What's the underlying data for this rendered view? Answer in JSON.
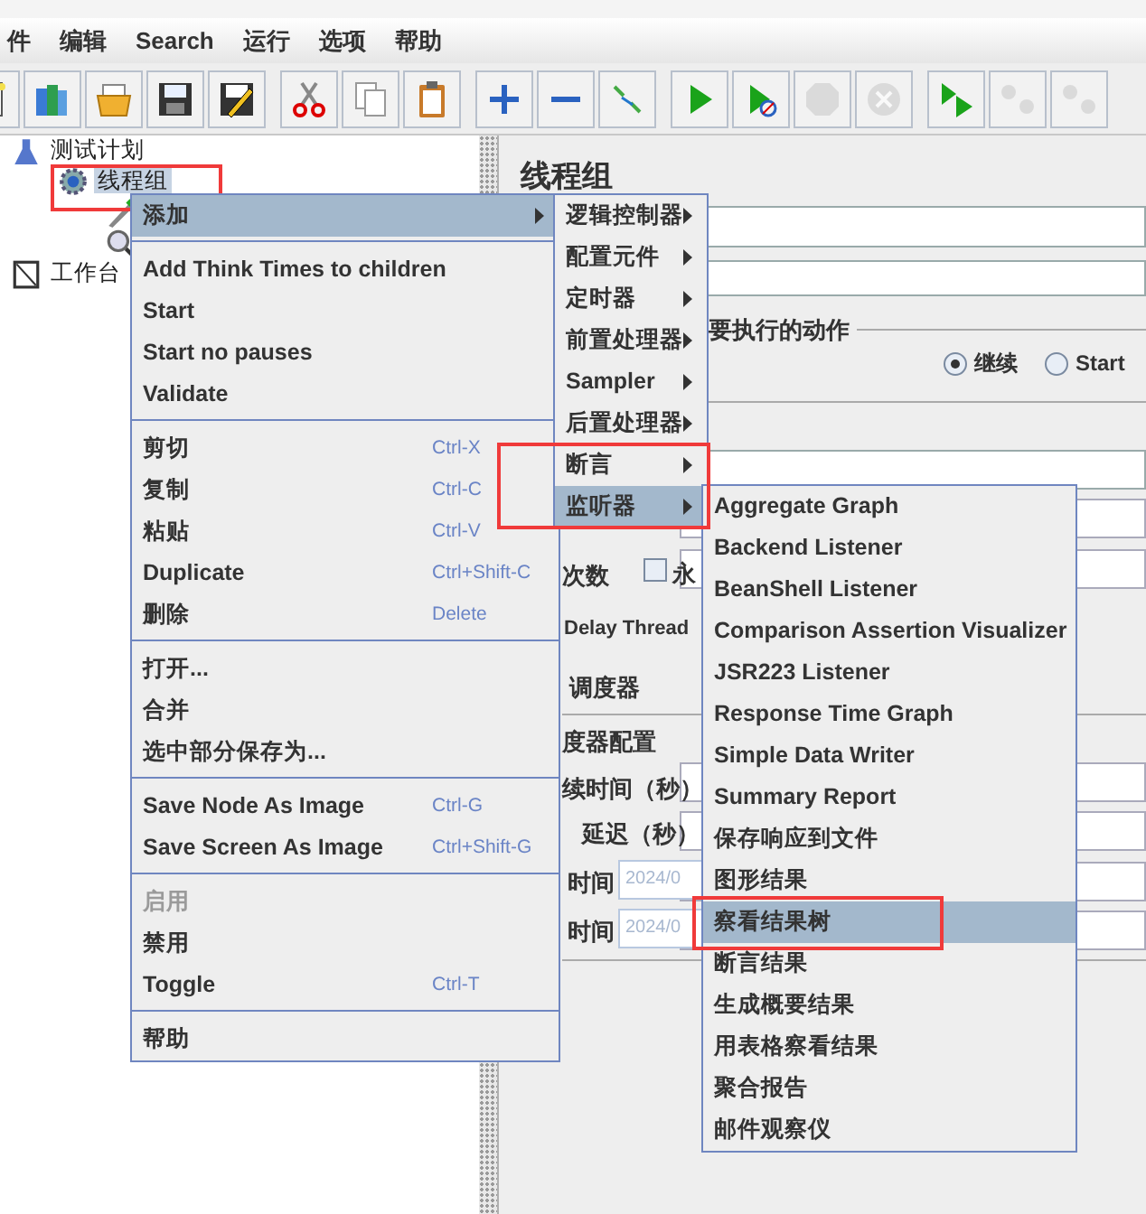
{
  "menu_bar": [
    "件",
    "编辑",
    "Search",
    "运行",
    "选项",
    "帮助"
  ],
  "toolbar": [
    [
      {
        "kind": "new",
        "disabled": false
      },
      {
        "kind": "templates",
        "disabled": false
      },
      {
        "kind": "open",
        "disabled": false
      },
      {
        "kind": "save",
        "disabled": false
      },
      {
        "kind": "save_as",
        "disabled": false
      }
    ],
    [
      {
        "kind": "cut",
        "disabled": false
      },
      {
        "kind": "copy",
        "disabled": false
      },
      {
        "kind": "paste",
        "disabled": false
      }
    ],
    [
      {
        "kind": "expand",
        "disabled": false
      },
      {
        "kind": "collapse",
        "disabled": false
      },
      {
        "kind": "toggle",
        "disabled": false
      }
    ],
    [
      {
        "kind": "start",
        "disabled": false
      },
      {
        "kind": "start_no_pauses",
        "disabled": false
      },
      {
        "kind": "stop",
        "disabled": true
      },
      {
        "kind": "shutdown",
        "disabled": true
      }
    ],
    [
      {
        "kind": "remote_start",
        "disabled": false
      },
      {
        "kind": "remote_stop",
        "disabled": true
      },
      {
        "kind": "remote_exit",
        "disabled": true
      }
    ]
  ],
  "tree": [
    {
      "kind": "test_plan",
      "label": "测试计划",
      "selected": false,
      "children": [
        {
          "kind": "thread_group",
          "label": "线程组",
          "selected": true,
          "children": [
            {
              "kind": "pencil"
            },
            {
              "kind": "magnifier"
            }
          ]
        }
      ]
    },
    {
      "kind": "workbench",
      "label": "工作台",
      "selected": false
    }
  ],
  "panel": {
    "title": "线程组",
    "action_group": "要执行的动作",
    "radios": [
      {
        "label": "继续",
        "selected": true
      },
      {
        "label": "Start",
        "selected": false
      }
    ],
    "loop_forever": {
      "checked": false
    },
    "labels": [
      "次数",
      "永",
      "Delay Thread",
      "调度器",
      "度器配置",
      "续时间（秒）",
      "延迟（秒）"
    ],
    "start_time": {
      "label": "时间",
      "value": "2024/0"
    },
    "end_time": {
      "label": "时间",
      "value": "2024/0"
    }
  },
  "context_menu": [
    {
      "kind": "submenu",
      "label": "添加",
      "selected": true,
      "disabled": false
    },
    {
      "kind": "separator"
    },
    {
      "kind": "item",
      "label": "Add Think Times to children",
      "selected": false,
      "disabled": false
    },
    {
      "kind": "item",
      "label": "Start",
      "selected": false,
      "disabled": false
    },
    {
      "kind": "item",
      "label": "Start no pauses",
      "selected": false,
      "disabled": false
    },
    {
      "kind": "item",
      "label": "Validate",
      "selected": false,
      "disabled": false
    },
    {
      "kind": "separator"
    },
    {
      "kind": "item",
      "label": "剪切",
      "shortcut": "Ctrl-X",
      "selected": false,
      "disabled": false
    },
    {
      "kind": "item",
      "label": "复制",
      "shortcut": "Ctrl-C",
      "selected": false,
      "disabled": false
    },
    {
      "kind": "item",
      "label": "粘贴",
      "shortcut": "Ctrl-V",
      "selected": false,
      "disabled": false
    },
    {
      "kind": "item",
      "label": "Duplicate",
      "shortcut": "Ctrl+Shift-C",
      "selected": false,
      "disabled": false
    },
    {
      "kind": "item",
      "label": "删除",
      "shortcut": "Delete",
      "selected": false,
      "disabled": false
    },
    {
      "kind": "separator"
    },
    {
      "kind": "item",
      "label": "打开...",
      "selected": false,
      "disabled": false
    },
    {
      "kind": "item",
      "label": "合并",
      "selected": false,
      "disabled": false
    },
    {
      "kind": "item",
      "label": "选中部分保存为...",
      "selected": false,
      "disabled": false
    },
    {
      "kind": "separator"
    },
    {
      "kind": "item",
      "label": "Save Node As Image",
      "shortcut": "Ctrl-G",
      "selected": false,
      "disabled": false
    },
    {
      "kind": "item",
      "label": "Save Screen As Image",
      "shortcut": "Ctrl+Shift-G",
      "selected": false,
      "disabled": false
    },
    {
      "kind": "separator"
    },
    {
      "kind": "item",
      "label": "启用",
      "selected": false,
      "disabled": true
    },
    {
      "kind": "item",
      "label": "禁用",
      "selected": false,
      "disabled": false
    },
    {
      "kind": "item",
      "label": "Toggle",
      "shortcut": "Ctrl-T",
      "selected": false,
      "disabled": false
    },
    {
      "kind": "separator"
    },
    {
      "kind": "item",
      "label": "帮助",
      "selected": false,
      "disabled": false
    }
  ],
  "add_submenu": [
    {
      "label": "逻辑控制器",
      "selected": false
    },
    {
      "label": "配置元件",
      "selected": false
    },
    {
      "label": "定时器",
      "selected": false
    },
    {
      "label": "前置处理器",
      "selected": false
    },
    {
      "label": "Sampler",
      "selected": false
    },
    {
      "label": "后置处理器",
      "selected": false
    },
    {
      "label": "断言",
      "selected": false
    },
    {
      "label": "监听器",
      "selected": true
    }
  ],
  "listener_submenu": [
    {
      "label": "Aggregate Graph",
      "selected": false
    },
    {
      "label": "Backend Listener",
      "selected": false
    },
    {
      "label": "BeanShell Listener",
      "selected": false
    },
    {
      "label": "Comparison Assertion Visualizer",
      "selected": false
    },
    {
      "label": "JSR223 Listener",
      "selected": false
    },
    {
      "label": "Response Time Graph",
      "selected": false
    },
    {
      "label": "Simple Data Writer",
      "selected": false
    },
    {
      "label": "Summary Report",
      "selected": false
    },
    {
      "label": "保存响应到文件",
      "selected": false
    },
    {
      "label": "图形结果",
      "selected": false
    },
    {
      "label": "察看结果树",
      "selected": true
    },
    {
      "label": "断言结果",
      "selected": false
    },
    {
      "label": "生成概要结果",
      "selected": false
    },
    {
      "label": "用表格察看结果",
      "selected": false
    },
    {
      "label": "聚合报告",
      "selected": false
    },
    {
      "label": "邮件观察仪",
      "selected": false
    }
  ]
}
